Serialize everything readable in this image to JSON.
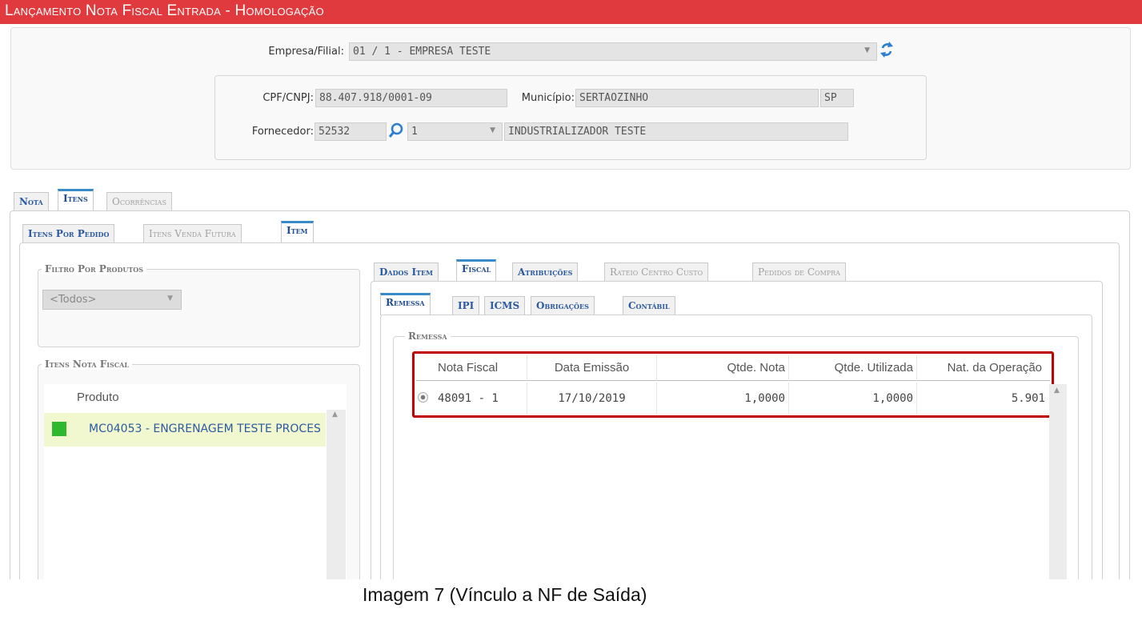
{
  "window": {
    "title": "Lançamento Nota Fiscal Entrada  - Homologação"
  },
  "header": {
    "empresa_label": "Empresa/Filial:",
    "empresa_value": "01 / 1 - EMPRESA TESTE",
    "cpf_label": "CPF/CNPJ:",
    "cpf_value": "88.407.918/0001-09",
    "municipio_label": "Município:",
    "municipio_value": "SERTAOZINHO",
    "uf_value": "SP",
    "fornecedor_label": "Fornecedor:",
    "fornecedor_code": "52532",
    "fornecedor_seq": "1",
    "fornecedor_name": "INDUSTRIALIZADOR TESTE"
  },
  "main_tabs": [
    {
      "label": "Nota",
      "state": "normal"
    },
    {
      "label": "Itens",
      "state": "active"
    },
    {
      "label": "Ocorrências",
      "state": "disabled"
    }
  ],
  "items_tabs": [
    {
      "label": "Itens Por Pedido",
      "state": "normal"
    },
    {
      "label": "Itens Venda Futura",
      "state": "disabled"
    },
    {
      "label": "Item",
      "state": "active"
    }
  ],
  "filter": {
    "legend": "Filtro Por Produtos",
    "select_value": "<Todos>"
  },
  "items_list": {
    "legend": "Itens Nota Fiscal",
    "column": "Produto",
    "rows": [
      {
        "text": "MC04053 - ENGRENAGEM TESTE PROCES",
        "status_color": "#2eb82e"
      }
    ]
  },
  "detail_tabs": [
    {
      "label": "Dados Item",
      "state": "normal"
    },
    {
      "label": "Fiscal",
      "state": "active"
    },
    {
      "label": "Atribuições",
      "state": "normal"
    },
    {
      "label": "Rateio Centro Custo",
      "state": "disabled"
    },
    {
      "label": "Pedidos de Compra",
      "state": "disabled"
    }
  ],
  "fiscal_tabs": [
    {
      "label": "Remessa",
      "state": "active"
    },
    {
      "label": "IPI",
      "state": "normal"
    },
    {
      "label": "ICMS",
      "state": "normal"
    },
    {
      "label": "Obrigações",
      "state": "normal"
    },
    {
      "label": "Contábil",
      "state": "normal"
    }
  ],
  "remessa": {
    "legend": "Remessa",
    "columns": [
      "Nota Fiscal",
      "Data Emissão",
      "Qtde. Nota",
      "Qtde. Utilizada",
      "Nat. da Operação"
    ],
    "rows": [
      {
        "nota": "48091 - 1",
        "data": "17/10/2019",
        "qtde_nota": "1,0000",
        "qtde_util": "1,0000",
        "nat_op": "5.901"
      }
    ]
  },
  "caption": "Imagem 7 (Vínculo a NF de Saída)",
  "colors": {
    "title_bar": "#e03a3e",
    "highlight_border": "#c00000",
    "tab_text": "#2b5aa0",
    "selected_row": "#f1f7cf"
  }
}
